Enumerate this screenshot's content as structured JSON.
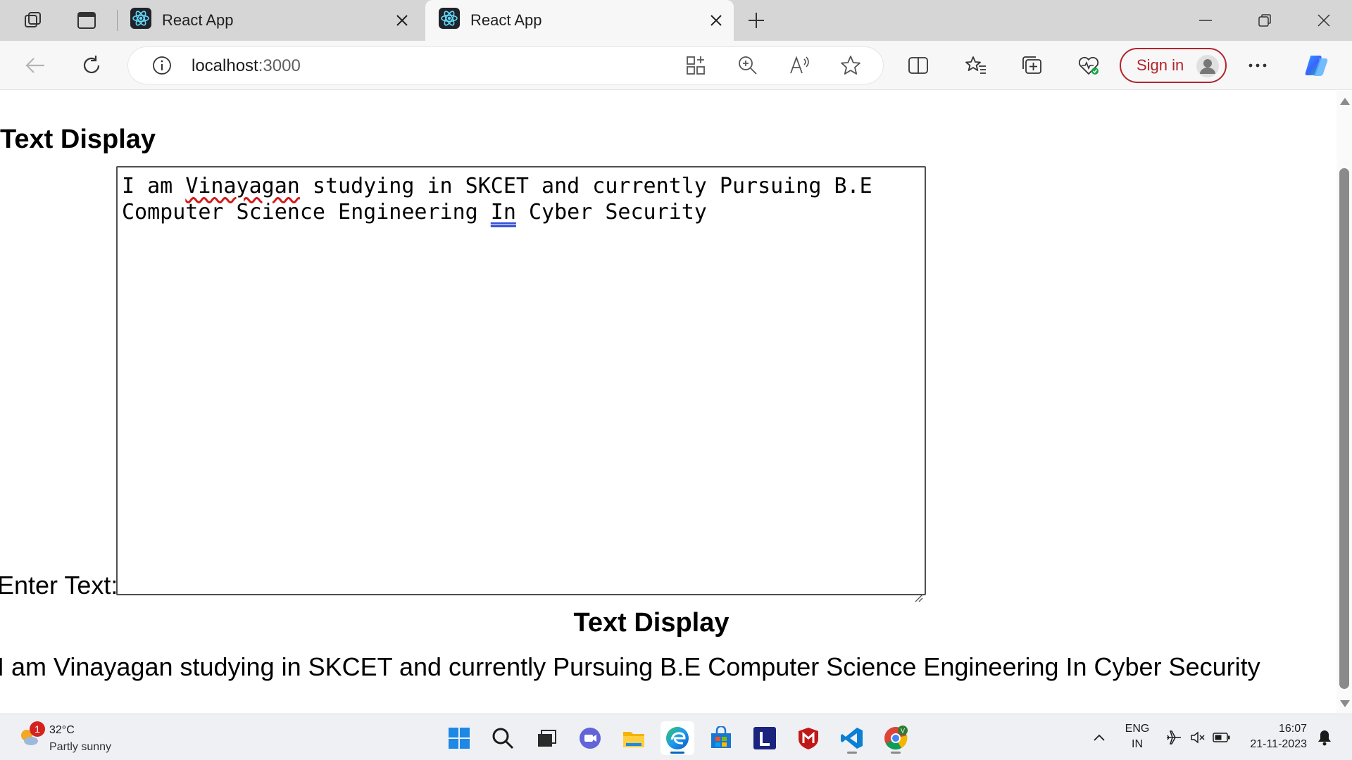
{
  "browser": {
    "tabs": [
      {
        "title": "React App",
        "active": false
      },
      {
        "title": "React App",
        "active": true
      }
    ],
    "address": {
      "host": "localhost",
      "port": ":3000"
    },
    "signin_label": "Sign in"
  },
  "page": {
    "heading": "Text Display",
    "input_label": "Enter Text:",
    "textarea_words": {
      "pre": "I am ",
      "misspelled": "Vinayagan",
      "mid": " studying in SKCET and currently Pursuing B.E\nComputer Science Engineering ",
      "grammar": "In",
      "post": " Cyber Security"
    },
    "output_heading": "Text Display",
    "output_text": "I am Vinayagan studying in SKCET and currently Pursuing B.E Computer Science Engineering In Cyber Security"
  },
  "taskbar": {
    "weather": {
      "temp": "32°C",
      "condition": "Partly sunny",
      "badge": "1"
    },
    "apps": [
      "start-icon",
      "search-icon",
      "task-view-icon",
      "chat-icon",
      "file-explorer-icon",
      "edge-icon",
      "store-icon",
      "l-app-icon",
      "mcafee-icon",
      "vscode-icon",
      "chrome-icon"
    ],
    "language": {
      "line1": "ENG",
      "line2": "IN"
    },
    "clock": {
      "time": "16:07",
      "date": "21-11-2023"
    }
  },
  "colors": {
    "tab_strip": "#d6d6d6",
    "toolbar": "#f7f7f7",
    "signin_accent": "#b4232a",
    "spellcheck": "#d11a1a",
    "grammar": "#3a55d6"
  }
}
